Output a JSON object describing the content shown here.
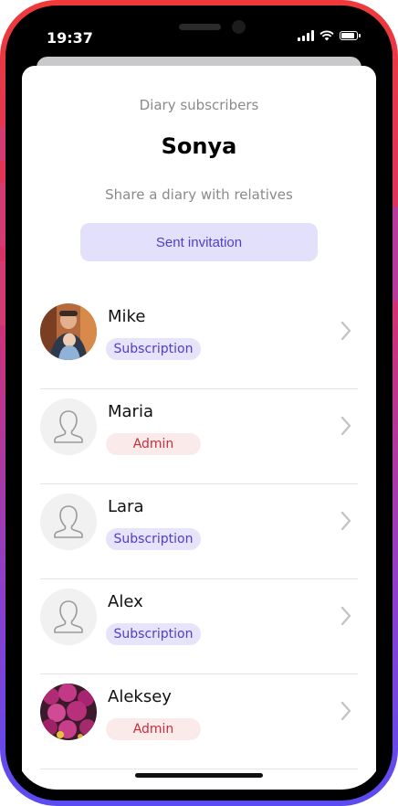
{
  "status_bar": {
    "time": "19:37"
  },
  "header": {
    "section_label": "Diary subscribers",
    "title": "Sonya",
    "subtitle": "Share a diary with relatives",
    "invite_button": "Sent invitation"
  },
  "subscribers": [
    {
      "name": "Mike",
      "role": "Subscription",
      "avatar": "photo-man-with-child"
    },
    {
      "name": "Maria",
      "role": "Admin",
      "avatar": "person-placeholder-icon"
    },
    {
      "name": "Lara",
      "role": "Subscription",
      "avatar": "person-placeholder-icon"
    },
    {
      "name": "Alex",
      "role": "Subscription",
      "avatar": "person-placeholder-icon"
    },
    {
      "name": "Aleksey",
      "role": "Admin",
      "avatar": "photo-pink-flowers"
    }
  ],
  "colors": {
    "accent": "#4f3fc6",
    "accent_bg": "#e3e0fb",
    "admin_text": "#c4303c",
    "admin_bg": "#fbeaea"
  }
}
